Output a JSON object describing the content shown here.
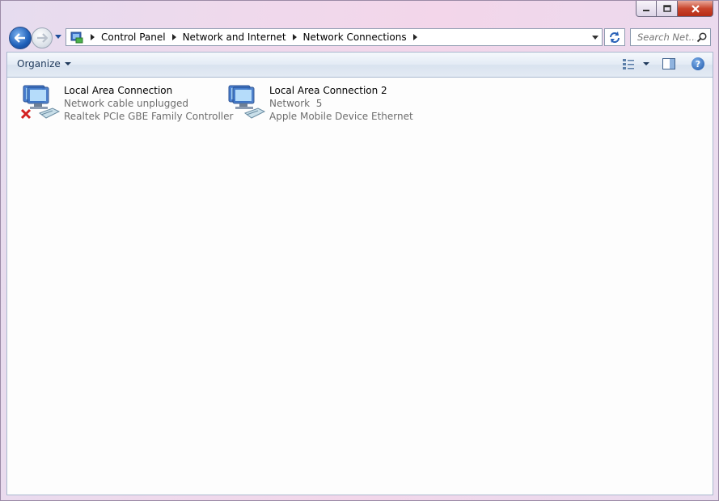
{
  "window": {
    "caption_buttons": [
      "minimize-icon",
      "maximize-icon",
      "close-icon"
    ]
  },
  "address_bar": {
    "breadcrumbs": [
      "Control Panel",
      "Network and Internet",
      "Network Connections"
    ]
  },
  "search": {
    "placeholder": "Search Net..."
  },
  "toolbar": {
    "organize_label": "Organize"
  },
  "connections": [
    {
      "name": "Local Area Connection",
      "status": "Network cable unplugged",
      "device": "Realtek PCIe GBE Family Controller",
      "disconnected": true
    },
    {
      "name": "Local Area Connection 2",
      "status": "Network  5",
      "device": "Apple Mobile Device Ethernet",
      "disconnected": false
    }
  ],
  "colors": {
    "accent": "#1e395b",
    "secondary_text": "#6d6d6d",
    "error_x": "#d32020"
  }
}
